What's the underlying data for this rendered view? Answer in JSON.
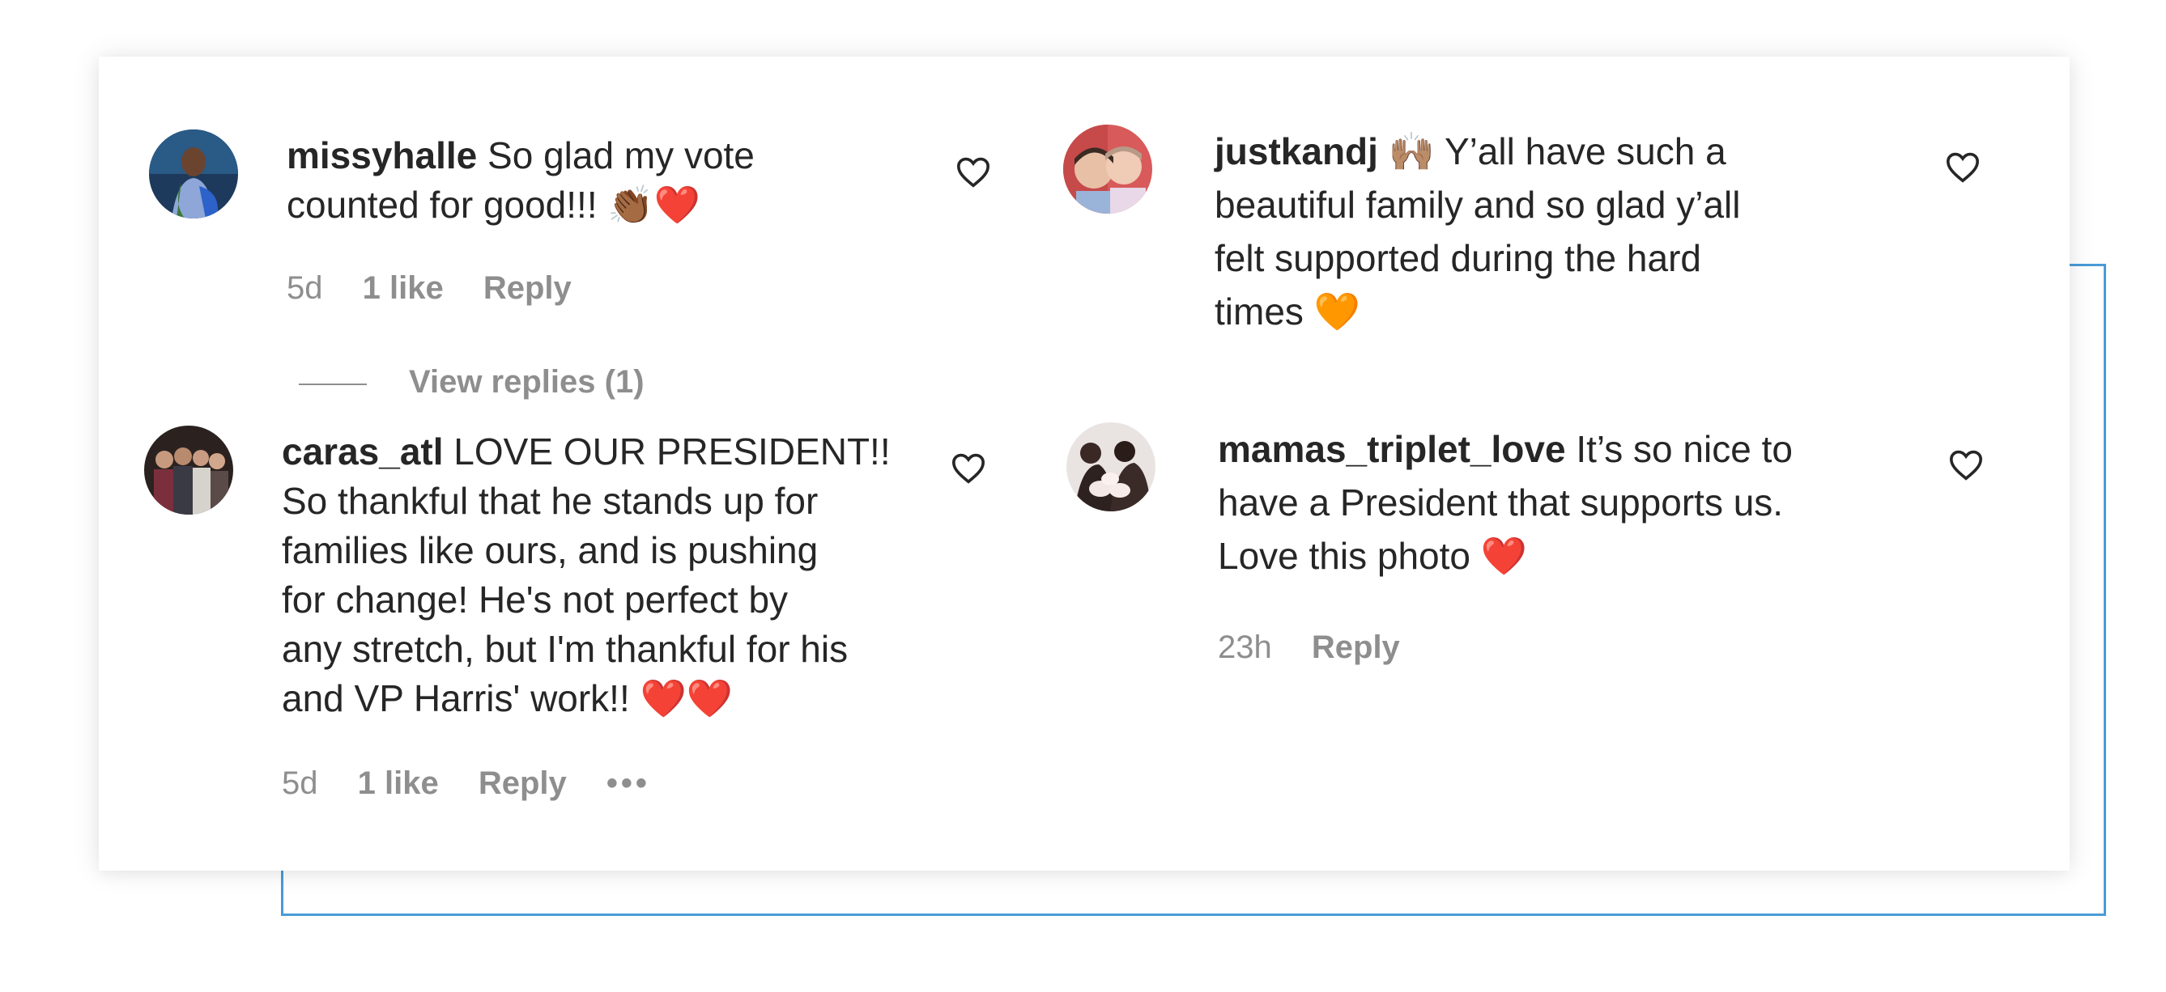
{
  "colors": {
    "accent_frame": "#4a9bd6",
    "text": "#262626",
    "muted": "#8e8e8e",
    "heart_emoji": "#e0245e",
    "orange_heart_emoji": "#f4a037"
  },
  "comments": [
    {
      "username": "missyhalle",
      "text": "So glad my vote counted for good!!! 👏🏾❤️",
      "lines": [
        "So glad my vote",
        "counted for good!!! 👏🏾❤️"
      ],
      "time": "5d",
      "likes": "1 like",
      "reply": "Reply",
      "view_replies": "View replies (1)",
      "avatar_icon": "profile-photo"
    },
    {
      "username": "caras_atl",
      "text": "LOVE OUR PRESIDENT!! So thankful that he stands up for families like ours, and is pushing for change! He's not perfect by any stretch, but I'm thankful for his and VP Harris' work!! ❤️❤️",
      "lines": [
        "LOVE OUR PRESIDENT!!",
        "So thankful that he stands up for",
        "families like ours, and is pushing",
        "for change! He's not perfect by",
        "any stretch, but I'm thankful for his",
        "and VP Harris' work!! ❤️❤️"
      ],
      "time": "5d",
      "likes": "1 like",
      "reply": "Reply",
      "more": "•••",
      "avatar_icon": "profile-photo"
    },
    {
      "username": "justkandj",
      "text": "🙌🏽 Y’all have such a beautiful family and so glad y’all felt supported during the hard times 🧡",
      "lines": [
        "🙌🏽 Y’all have such a",
        "beautiful family and so glad y’all",
        "felt supported during the hard",
        "times 🧡"
      ],
      "avatar_icon": "profile-photo"
    },
    {
      "username": "mamas_triplet_love",
      "text": "It’s so nice to have a President that supports us. Love this photo ❤️",
      "lines": [
        "It’s so nice to",
        "have a President that supports us.",
        "Love this photo ❤️"
      ],
      "time": "23h",
      "reply": "Reply",
      "avatar_icon": "profile-photo"
    }
  ]
}
